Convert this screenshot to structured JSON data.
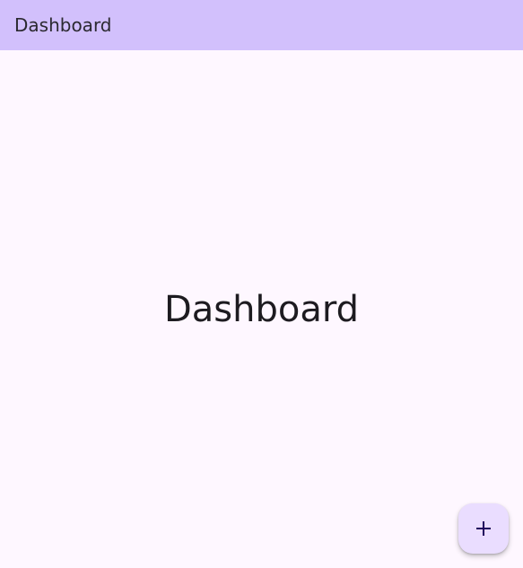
{
  "app_bar": {
    "title": "Dashboard"
  },
  "main": {
    "title": "Dashboard"
  },
  "fab": {
    "icon": "add-icon"
  }
}
